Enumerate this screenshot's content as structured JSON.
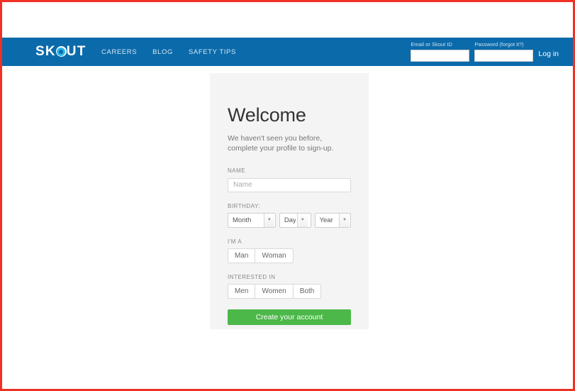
{
  "navbar": {
    "logo_text_before": "SK",
    "logo_icon": "target-circle-icon",
    "logo_text_after": "UT",
    "links": [
      {
        "label": "CAREERS"
      },
      {
        "label": "BLOG"
      },
      {
        "label": "SAFETY TIPS"
      }
    ],
    "login": {
      "email_label": "Email or Skout ID",
      "email_value": "",
      "email_placeholder": "",
      "password_label": "Password (forgot it?)",
      "password_value": "",
      "password_placeholder": "",
      "login_button": "Log in"
    },
    "background_color": "#0b6aaa"
  },
  "card": {
    "heading": "Welcome",
    "subtitle": "We haven't seen you before, complete your profile to sign-up.",
    "name": {
      "label": "NAME",
      "value": "",
      "placeholder": "Name"
    },
    "birthday": {
      "label": "BIRTHDAY:",
      "month_selected": "Month",
      "day_selected": "Day",
      "year_selected": "Year"
    },
    "im_a": {
      "label": "I'M A",
      "options": [
        {
          "label": "Man"
        },
        {
          "label": "Woman"
        }
      ]
    },
    "interested_in": {
      "label": "INTERESTED IN",
      "options": [
        {
          "label": "Men"
        },
        {
          "label": "Women"
        },
        {
          "label": "Both"
        }
      ]
    },
    "cta_label": "Create your account",
    "cta_color": "#4cb849",
    "background_color": "#f4f4f4"
  },
  "page": {
    "border_color": "#ee3124",
    "background_color": "#ffffff"
  }
}
